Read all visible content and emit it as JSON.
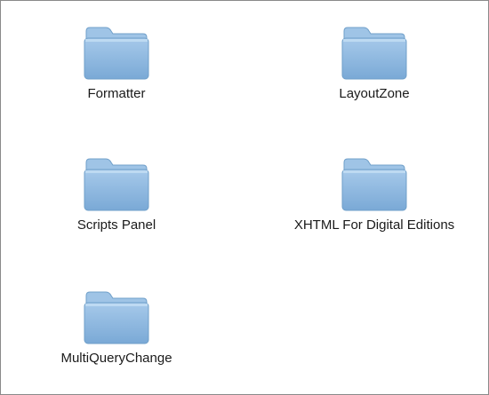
{
  "folders": [
    {
      "label": "Formatter",
      "icon": "folder-icon"
    },
    {
      "label": "LayoutZone",
      "icon": "folder-icon"
    },
    {
      "label": "Scripts Panel",
      "icon": "folder-icon"
    },
    {
      "label": "XHTML For Digital Editions",
      "icon": "folder-icon"
    },
    {
      "label": "MultiQueryChange",
      "icon": "folder-icon"
    }
  ],
  "colors": {
    "folder_body": "#8eb9df",
    "folder_tab": "#a8cbe9",
    "folder_edge": "#6f9fc9",
    "background": "#ffffff",
    "border": "#8a8a8a"
  }
}
